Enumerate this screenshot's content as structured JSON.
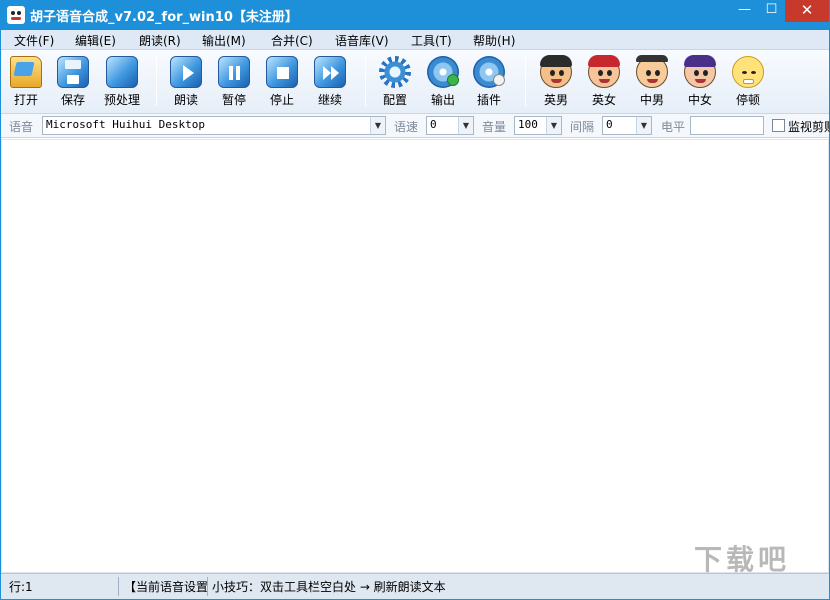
{
  "window": {
    "title": "胡子语音合成_v7.02_for_win10【未注册】",
    "controls": {
      "minimize": "—",
      "maximize": "☐",
      "close": "✕"
    }
  },
  "menu": [
    "文件(F)",
    "编辑(E)",
    "朗读(R)",
    "输出(M)",
    "合并(C)",
    "语音库(V)",
    "工具(T)",
    "帮助(H)"
  ],
  "toolbar": {
    "buttons": [
      {
        "label": "打开",
        "icon": "open-folder-icon"
      },
      {
        "label": "保存",
        "icon": "save-disk-icon"
      },
      {
        "label": "预处理",
        "icon": "preprocess-icon"
      },
      {
        "label": "朗读",
        "icon": "play-icon"
      },
      {
        "label": "暂停",
        "icon": "pause-icon"
      },
      {
        "label": "停止",
        "icon": "stop-icon"
      },
      {
        "label": "继续",
        "icon": "fast-forward-icon"
      },
      {
        "label": "配置",
        "icon": "gear-icon"
      },
      {
        "label": "输出",
        "icon": "output-disc-icon"
      },
      {
        "label": "插件",
        "icon": "plugin-disc-icon"
      },
      {
        "label": "英男",
        "icon": "english-male-face-icon"
      },
      {
        "label": "英女",
        "icon": "english-female-face-icon"
      },
      {
        "label": "中男",
        "icon": "chinese-male-face-icon"
      },
      {
        "label": "中女",
        "icon": "chinese-female-face-icon"
      },
      {
        "label": "停顿",
        "icon": "pause-face-icon"
      }
    ]
  },
  "options": {
    "voice_label": "语音",
    "voice_value": "Microsoft Huihui Desktop",
    "speed_label": "语速",
    "speed_value": "0",
    "volume_label": "音量",
    "volume_value": "100",
    "interval_label": "间隔",
    "interval_value": "0",
    "level_label": "电平",
    "level_value": "",
    "monitor_label": "监视剪贴",
    "monitor_checked": false
  },
  "editor": {
    "content": ""
  },
  "status": {
    "line": "行:1",
    "voice_settings": "【当前语音设置",
    "tip": "小技巧：双击工具栏空白处 → 刷新朗读文本"
  },
  "watermark": "下载吧",
  "colors": {
    "titlebar": "#1e8fd9",
    "menubar": "#dfe9f5",
    "close_button": "#c7392a",
    "status_bar": "#dfe7f1"
  }
}
